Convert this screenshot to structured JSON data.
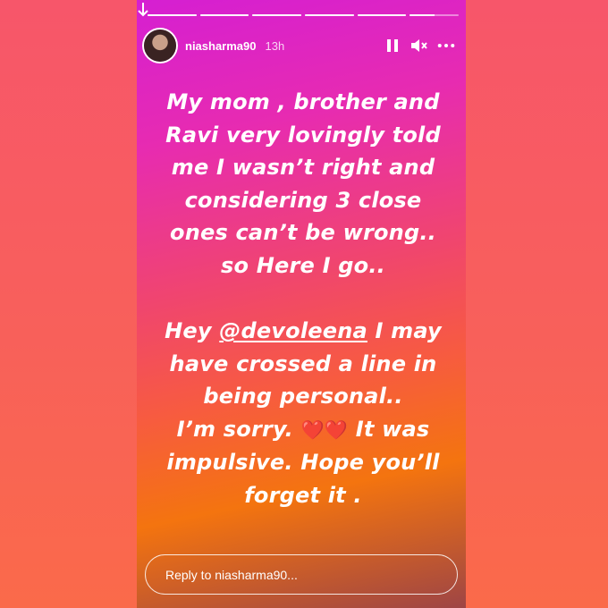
{
  "story": {
    "progress": [
      1,
      1,
      1,
      1,
      1,
      0.5
    ],
    "user": {
      "username": "niasharma90",
      "time": "13h"
    },
    "controls": {
      "pause_icon": "pause-icon",
      "mute_icon": "mute-icon",
      "more_icon": "more-icon"
    },
    "message": {
      "lines_part1": [
        "My mom , brother and",
        "Ravi very lovingly told",
        "me I wasn’t right and",
        "considering 3 close",
        "ones can’t be wrong..",
        "so Here I go.."
      ],
      "hey_prefix": "Hey ",
      "mention": "@devoleena",
      "hey_suffix": " I may",
      "lines_part2": [
        "have crossed a line in",
        "being personal.."
      ],
      "sorry_prefix": "I’m sorry. ",
      "emoji": "❤️❤️",
      "sorry_suffix": "  It was",
      "lines_part3": [
        "impulsive. Hope you’ll",
        "forget it ."
      ]
    },
    "reply_placeholder": "Reply to niasharma90..."
  },
  "colors": {
    "gradient_top": "#d51fd2",
    "gradient_mid": "#f0456f",
    "gradient_bottom": "#f4740f",
    "page_background": "#f85f5c"
  }
}
